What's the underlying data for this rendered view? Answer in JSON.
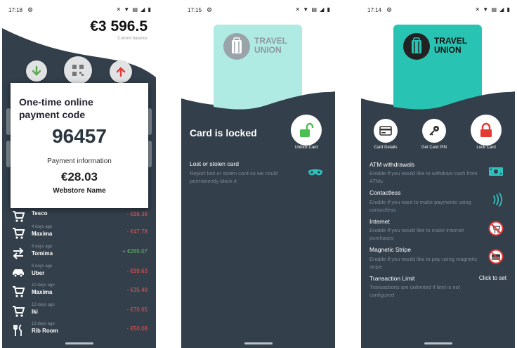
{
  "phone1": {
    "status": {
      "time": "17:18",
      "icons": "✕ ▼ ▤ ◢ ▮"
    },
    "balance": {
      "amount": "€3 596.5",
      "label": "Current balance"
    },
    "modal": {
      "title": "One-time online payment code",
      "code": "96457",
      "info_label": "Payment information",
      "amount": "€28.03",
      "merchant": "Webstore Name"
    },
    "transactions": [
      {
        "date": "",
        "name": "Tesco",
        "amount": "- €88.38",
        "type": "neg",
        "icon": "cart-icon"
      },
      {
        "date": "4 days ago",
        "name": "Maxima",
        "amount": "- €47.78",
        "type": "neg",
        "icon": "cart-icon"
      },
      {
        "date": "6 days ago",
        "name": "Tomima",
        "amount": "+ €265.07",
        "type": "pos",
        "icon": "transfer-icon"
      },
      {
        "date": "8 days ago",
        "name": "Uber",
        "amount": "- €99.63",
        "type": "neg",
        "icon": "car-icon"
      },
      {
        "date": "10 days ago",
        "name": "Maxima",
        "amount": "- €35.49",
        "type": "neg",
        "icon": "cart-icon"
      },
      {
        "date": "12 days ago",
        "name": "Iki",
        "amount": "- €70.65",
        "type": "neg",
        "icon": "cart-icon"
      },
      {
        "date": "13 days ago",
        "name": "Rib Room",
        "amount": "- €50.08",
        "type": "neg",
        "icon": "restaurant-icon"
      }
    ],
    "colors": {
      "receive": "#5aa94b",
      "send": "#e53935",
      "background": "#333f4b"
    }
  },
  "phone2": {
    "status": {
      "time": "17:15",
      "icons": "✕ ▼ ▤ ◢ ▮"
    },
    "card": {
      "line1": "TRAVEL",
      "line2": "UNION",
      "color": "#b0ebe3"
    },
    "locked_title": "Card is locked",
    "unlock_label": "Unlock Card",
    "lost": {
      "title": "Lost or stolen card",
      "sub": "Report lost or stolen card so we could permanently block it"
    },
    "colors": {
      "accent": "#4cbf53",
      "teal": "#31c1bd"
    }
  },
  "phone3": {
    "status": {
      "time": "17:14",
      "icons": "✕ ▼ ▤ ◢ ▮"
    },
    "card": {
      "line1": "TRAVEL",
      "line2": "UNION",
      "color": "#28c3b2"
    },
    "actions": [
      {
        "label": "Card Details",
        "icon": "card-icon"
      },
      {
        "label": "Get Card PIN",
        "icon": "key-icon"
      },
      {
        "label": "Lock Card",
        "icon": "lock-icon"
      }
    ],
    "options": [
      {
        "title": "ATM withdrawals",
        "sub": "Enable if you would like to withdraw cash from ATMs",
        "icon": "cash-icon"
      },
      {
        "title": "Contactless",
        "sub": "Enable if you want to make payments using contactless",
        "icon": "contactless-icon"
      },
      {
        "title": "Internet",
        "sub": "Enable if you would like to make internet purchases",
        "icon": "no-cart-icon"
      },
      {
        "title": "Magnetic Stripe",
        "sub": "Enable if you would like to pay using magnetic stripe",
        "icon": "stripe-card-icon"
      },
      {
        "title": "Transaction Limit",
        "sub": "Transactions are unlimited if limit is not configured",
        "icon": ""
      }
    ],
    "click_to_set": "Click to set",
    "colors": {
      "lock": "#e53935",
      "teal": "#31c1bd"
    }
  }
}
